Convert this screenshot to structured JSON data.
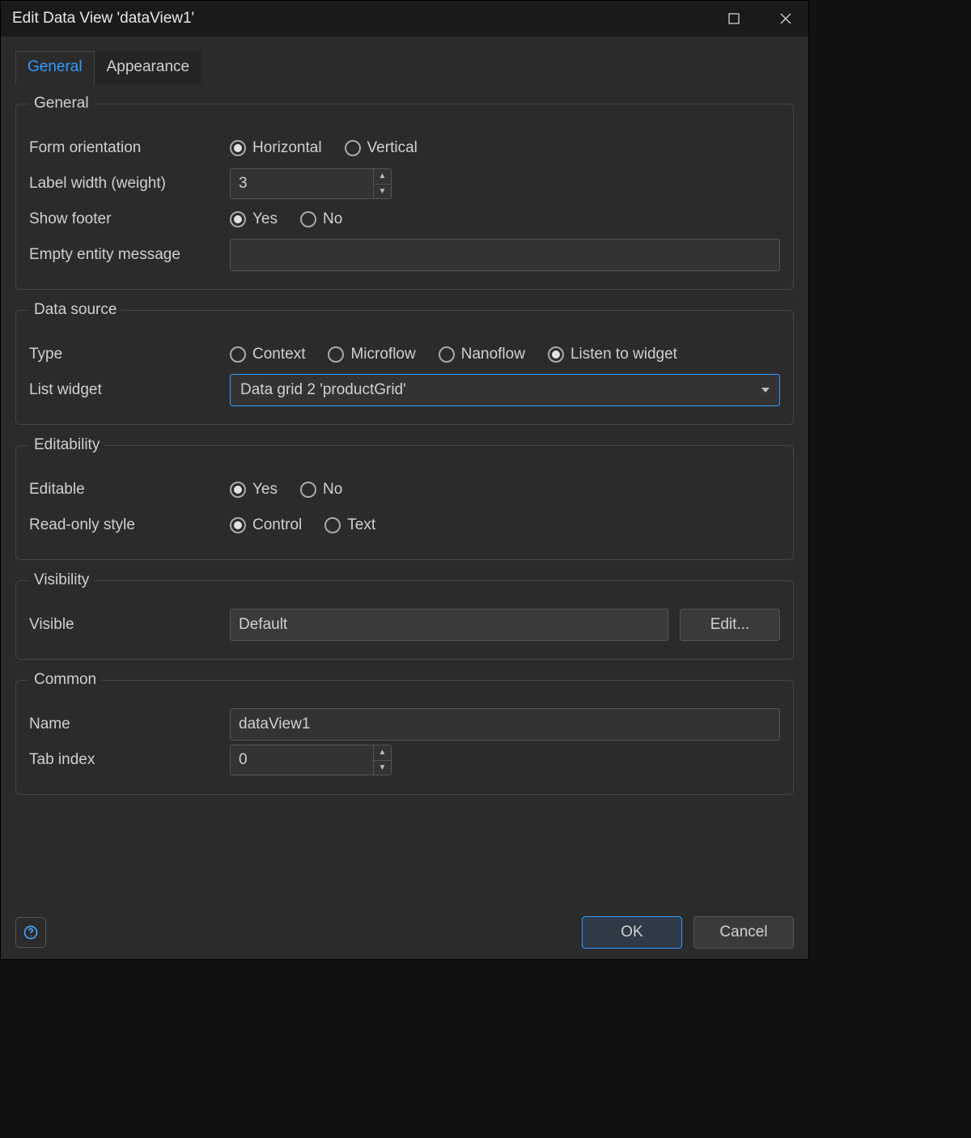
{
  "window": {
    "title": "Edit Data View 'dataView1'"
  },
  "tabs": {
    "general": "General",
    "appearance": "Appearance",
    "active": "general"
  },
  "groups": {
    "general": {
      "legend": "General",
      "form_orientation": {
        "label": "Form orientation",
        "options": {
          "horizontal": "Horizontal",
          "vertical": "Vertical"
        },
        "value": "horizontal"
      },
      "label_width": {
        "label": "Label width (weight)",
        "value": "3"
      },
      "show_footer": {
        "label": "Show footer",
        "options": {
          "yes": "Yes",
          "no": "No"
        },
        "value": "yes"
      },
      "empty_entity": {
        "label": "Empty entity message",
        "value": ""
      }
    },
    "data_source": {
      "legend": "Data source",
      "type": {
        "label": "Type",
        "options": {
          "context": "Context",
          "microflow": "Microflow",
          "nanoflow": "Nanoflow",
          "listen": "Listen to widget"
        },
        "value": "listen"
      },
      "list_widget": {
        "label": "List widget",
        "value": "Data grid 2 'productGrid'"
      }
    },
    "editability": {
      "legend": "Editability",
      "editable": {
        "label": "Editable",
        "options": {
          "yes": "Yes",
          "no": "No"
        },
        "value": "yes"
      },
      "readonly_style": {
        "label": "Read-only style",
        "options": {
          "control": "Control",
          "text": "Text"
        },
        "value": "control"
      }
    },
    "visibility": {
      "legend": "Visibility",
      "visible": {
        "label": "Visible",
        "value": "Default",
        "edit_label": "Edit..."
      }
    },
    "common": {
      "legend": "Common",
      "name": {
        "label": "Name",
        "value": "dataView1"
      },
      "tab_index": {
        "label": "Tab index",
        "value": "0"
      }
    }
  },
  "footer": {
    "ok": "OK",
    "cancel": "Cancel"
  }
}
